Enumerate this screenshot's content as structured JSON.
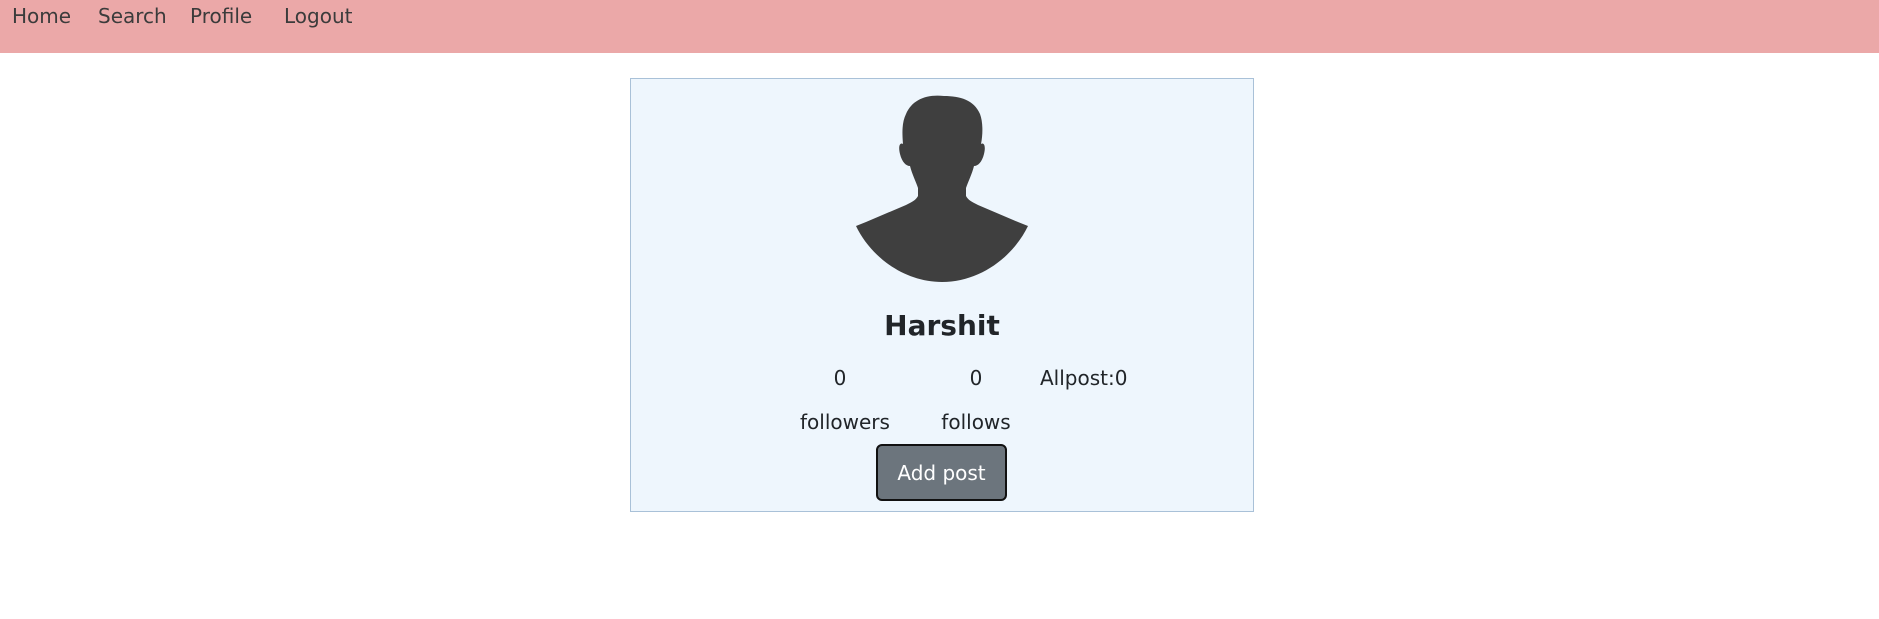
{
  "nav": {
    "home": "Home",
    "search": "Search",
    "profile": "Profile",
    "logout": "Logout"
  },
  "profile": {
    "avatar_icon": "user-silhouette-icon",
    "name": "Harshit",
    "followers_count": "0",
    "followers_label": "followers",
    "follows_count": "0",
    "follows_label": "follows",
    "allpost_text": "Allpost:0",
    "add_post_label": "Add post"
  },
  "colors": {
    "navbar_bg": "#eba8a8",
    "card_bg": "#eef6fd",
    "button_bg": "#6c757d"
  }
}
